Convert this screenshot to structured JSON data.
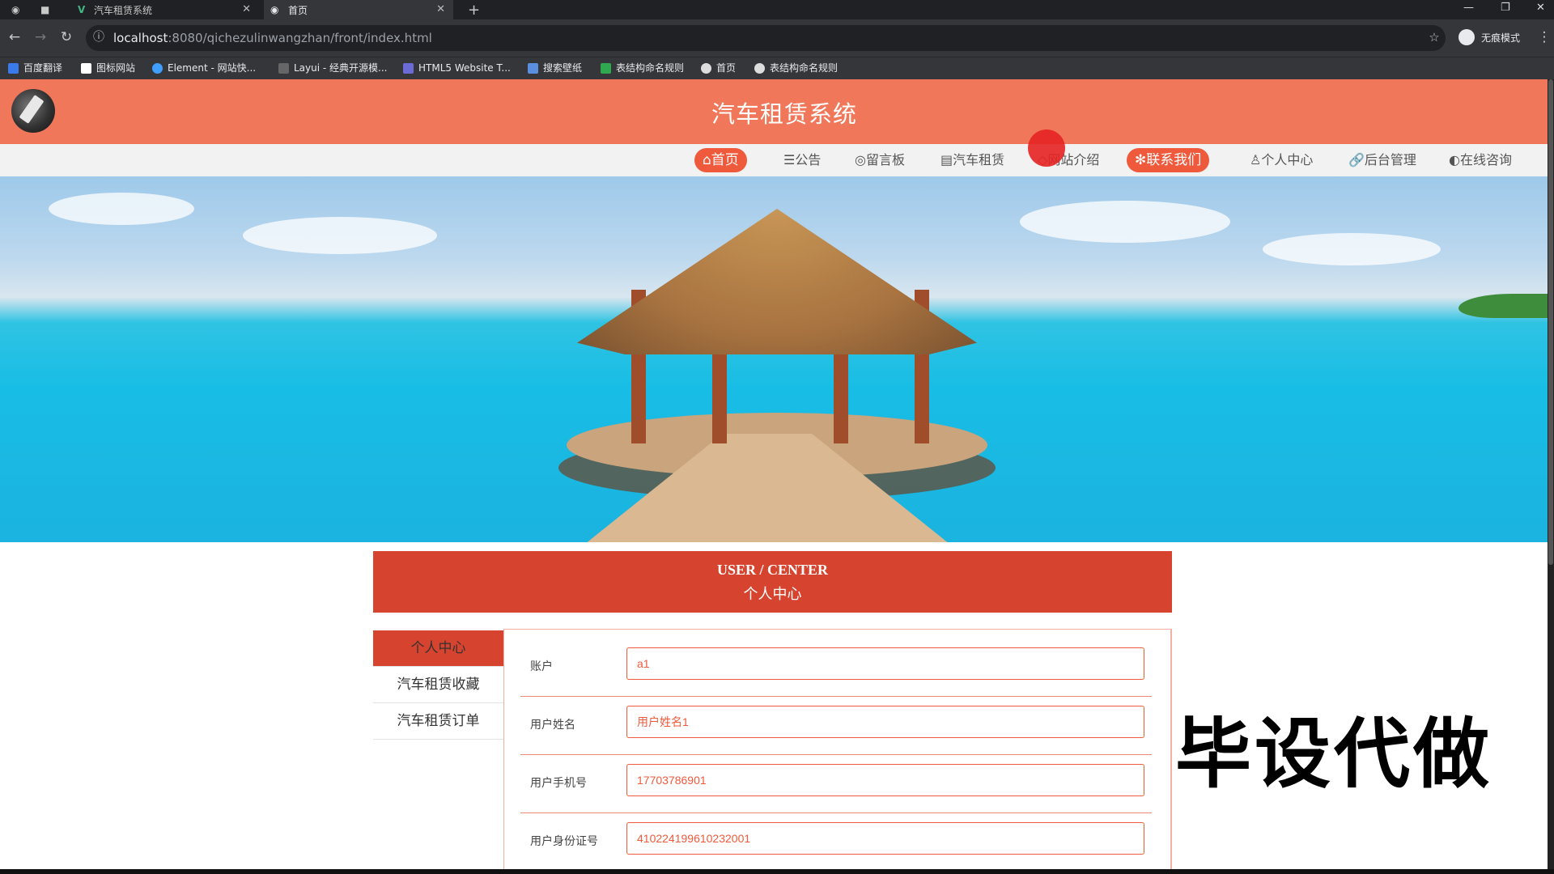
{
  "browser": {
    "tabs": [
      {
        "title": "汽车租赁系统",
        "icon": "vue-icon"
      },
      {
        "title": "首页",
        "icon": "globe-icon"
      }
    ],
    "url_host": "localhost",
    "url_path": ":8080/qichezulinwangzhan/front/index.html",
    "profile_label": "无痕模式",
    "bookmarks": [
      "百度翻译",
      "图标网站",
      "Element - 网站快...",
      "Layui - 经典开源模...",
      "HTML5 Website T...",
      "搜索壁纸",
      "表结构命名规则",
      "首页",
      "表结构命名规则"
    ]
  },
  "site": {
    "title": "汽车租赁系统",
    "nav": [
      "首页",
      "公告",
      "留言板",
      "汽车租赁",
      "网站介绍",
      "联系我们",
      "个人中心",
      "后台管理",
      "在线咨询"
    ],
    "nav_icons": [
      "⌂",
      "☰",
      "◎",
      "▤",
      "◇",
      "✻",
      "♙",
      "🔗",
      "◐"
    ],
    "active_nav": "首页",
    "highlight_nav": "联系我们"
  },
  "center": {
    "en_title": "USER / CENTER",
    "cn_title": "个人中心",
    "menu": [
      "个人中心",
      "汽车租赁收藏",
      "汽车租赁订单"
    ],
    "active_menu": "个人中心"
  },
  "form": {
    "fields": [
      {
        "label": "账户",
        "value": "a1"
      },
      {
        "label": "用户姓名",
        "value": "用户姓名1"
      },
      {
        "label": "用户手机号",
        "value": "17703786901"
      },
      {
        "label": "用户身份证号",
        "value": "410224199610232001"
      }
    ]
  },
  "watermark": "毕设代做",
  "colors": {
    "primary": "#ef5a3c",
    "header": "#f0775a",
    "panel": "#d6432e"
  }
}
